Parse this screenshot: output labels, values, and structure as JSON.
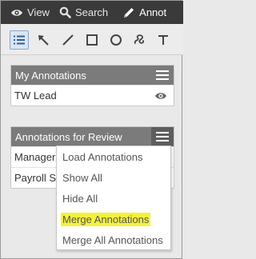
{
  "topbar": {
    "items": [
      {
        "label": "View",
        "icon": "eye-icon"
      },
      {
        "label": "Search",
        "icon": "search-icon"
      },
      {
        "label": "Annot",
        "icon": "pencil-icon"
      }
    ]
  },
  "toolbar": {
    "tools": [
      "list-select-icon",
      "arrow-icon",
      "line-icon",
      "rectangle-icon",
      "ellipse-icon",
      "freehand-icon",
      "text-icon"
    ],
    "active": "list-select-icon"
  },
  "my_annotations": {
    "title": "My Annotations",
    "rows": [
      {
        "label": "TW Lead",
        "visible": true
      }
    ]
  },
  "review_annotations": {
    "title": "Annotations for Review",
    "rows": [
      {
        "label": "Manager"
      },
      {
        "label": "Payroll S"
      }
    ]
  },
  "menu": {
    "items": [
      "Load Annotations",
      "Show All",
      "Hide All",
      "Merge Annotations",
      "Merge All Annotations"
    ],
    "highlighted": "Merge Annotations"
  },
  "colors": {
    "topbar": "#3a3a3a",
    "panel_header": "#7b7b7b",
    "highlight": "#f5f23a",
    "active_tool": "#d9e6f3"
  }
}
